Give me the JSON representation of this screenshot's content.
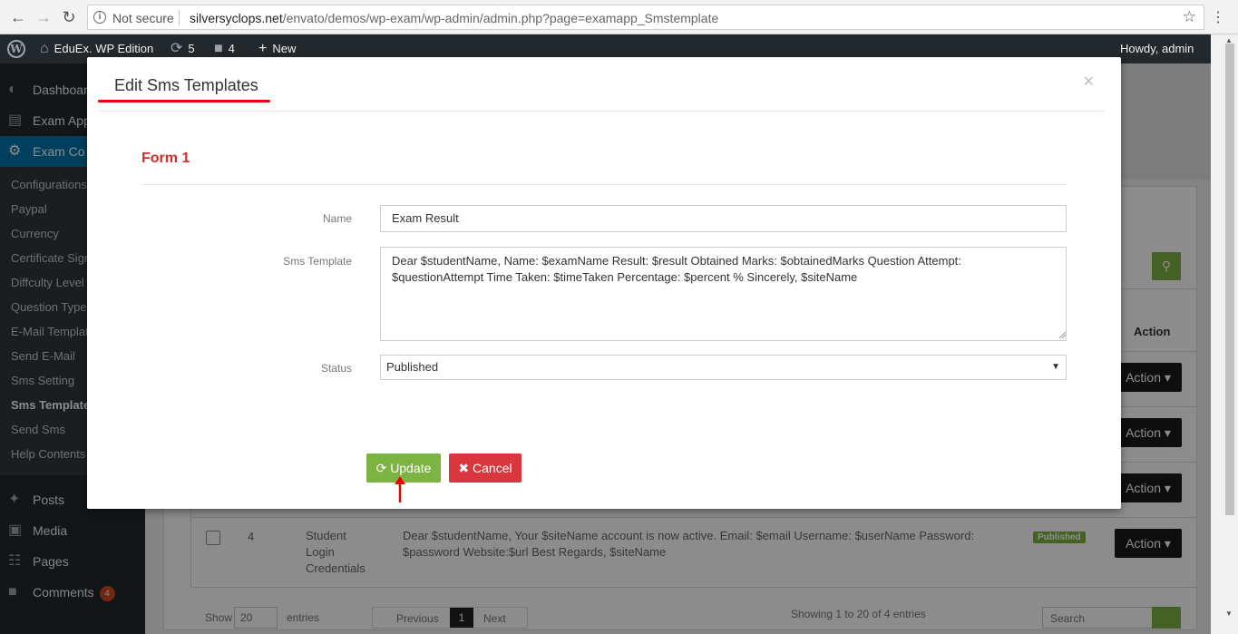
{
  "browser": {
    "secure_label": "Not secure",
    "url_host": "silversyclops.net",
    "url_path": "/envato/demos/wp-exam/wp-admin/admin.php?page=examapp_Smstemplate"
  },
  "adminbar": {
    "site_name": "EduEx. WP Edition",
    "updates": "5",
    "comments": "4",
    "new_label": "New",
    "howdy": "Howdy, admin"
  },
  "sidebar": {
    "top_items": [
      {
        "label": "Dashboard",
        "icon": "dashboard-icon"
      },
      {
        "label": "Exam App",
        "icon": "exam-app-icon"
      },
      {
        "label": "Exam Co",
        "icon": "gear-icon"
      }
    ],
    "submenu": [
      "Configurations",
      "Paypal",
      "Currency",
      "Certificate Sign",
      "Diffculty Level",
      "Question Type",
      "E-Mail Templat",
      "Send E-Mail",
      "Sms Setting",
      "Sms Template",
      "Send Sms",
      "Help Contents"
    ],
    "bottom_items": [
      {
        "label": "Posts",
        "icon": "pin-icon"
      },
      {
        "label": "Media",
        "icon": "media-icon"
      },
      {
        "label": "Pages",
        "icon": "pages-icon"
      },
      {
        "label": "Comments",
        "icon": "comment-icon",
        "badge": "4"
      }
    ]
  },
  "background": {
    "action_header": "Action",
    "action_label": "Action",
    "row4": {
      "number": "4",
      "name": "Student Login Credentials",
      "template": "Dear $studentName, Your $siteName account is now active. Email: $email Username: $userName Password: $password Website:$url Best Regards, $siteName",
      "status": "Published"
    },
    "show_label": "Show",
    "show_value": "20",
    "entries_label": "entries",
    "prev_label": "Previous",
    "page_number": "1",
    "next_label": "Next",
    "showing_text": "Showing 1 to 20 of 4 entries",
    "search_placeholder": "Search"
  },
  "modal": {
    "title": "Edit Sms Templates",
    "close": "×",
    "form_title": "Form 1",
    "name_label": "Name",
    "name_value": "Exam Result",
    "template_label": "Sms Template",
    "template_value": "Dear $studentName, Name: $examName Result: $result Obtained Marks: $obtainedMarks Question Attempt: $questionAttempt Time Taken: $timeTaken Percentage: $percent % Sincerely, $siteName",
    "status_label": "Status",
    "status_value": "Published",
    "update_label": "Update",
    "cancel_label": "Cancel"
  },
  "colors": {
    "accent_green": "#7cb342",
    "cancel_red": "#d9363e",
    "wp_blue": "#0073aa",
    "annotation_red": "#e00000"
  }
}
